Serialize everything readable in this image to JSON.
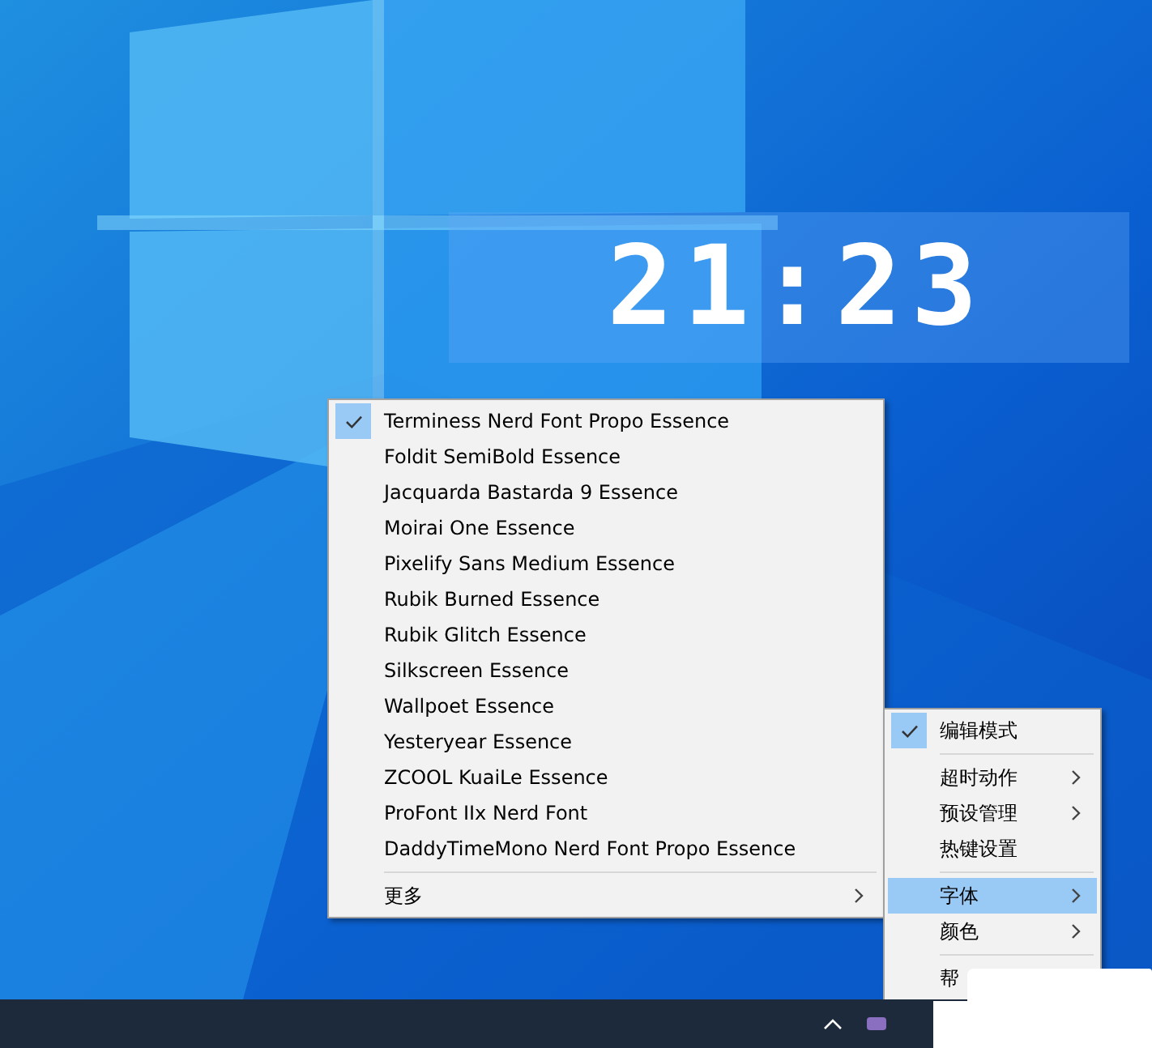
{
  "clock": {
    "time": "21:23"
  },
  "font_menu": {
    "items": [
      {
        "kind": "item",
        "label": "Terminess Nerd Font Propo Essence",
        "checked": true,
        "submenu": false,
        "selected": false
      },
      {
        "kind": "item",
        "label": "Foldit SemiBold Essence",
        "checked": false,
        "submenu": false,
        "selected": false
      },
      {
        "kind": "item",
        "label": "Jacquarda Bastarda 9 Essence",
        "checked": false,
        "submenu": false,
        "selected": false
      },
      {
        "kind": "item",
        "label": "Moirai One Essence",
        "checked": false,
        "submenu": false,
        "selected": false
      },
      {
        "kind": "item",
        "label": "Pixelify Sans Medium Essence",
        "checked": false,
        "submenu": false,
        "selected": false
      },
      {
        "kind": "item",
        "label": "Rubik Burned Essence",
        "checked": false,
        "submenu": false,
        "selected": false
      },
      {
        "kind": "item",
        "label": "Rubik Glitch Essence",
        "checked": false,
        "submenu": false,
        "selected": false
      },
      {
        "kind": "item",
        "label": "Silkscreen Essence",
        "checked": false,
        "submenu": false,
        "selected": false
      },
      {
        "kind": "item",
        "label": "Wallpoet Essence",
        "checked": false,
        "submenu": false,
        "selected": false
      },
      {
        "kind": "item",
        "label": "Yesteryear Essence",
        "checked": false,
        "submenu": false,
        "selected": false
      },
      {
        "kind": "item",
        "label": "ZCOOL KuaiLe Essence",
        "checked": false,
        "submenu": false,
        "selected": false
      },
      {
        "kind": "item",
        "label": "ProFont IIx Nerd Font",
        "checked": false,
        "submenu": false,
        "selected": false
      },
      {
        "kind": "item",
        "label": "DaddyTimeMono Nerd Font Propo Essence",
        "checked": false,
        "submenu": false,
        "selected": false
      },
      {
        "kind": "separator"
      },
      {
        "kind": "item",
        "label": "更多",
        "checked": false,
        "submenu": true,
        "selected": false
      }
    ]
  },
  "tray_menu": {
    "items": [
      {
        "kind": "item",
        "label": "编辑模式",
        "checked": true,
        "submenu": false,
        "selected": false
      },
      {
        "kind": "separator"
      },
      {
        "kind": "item",
        "label": "超时动作",
        "checked": false,
        "submenu": true,
        "selected": false
      },
      {
        "kind": "item",
        "label": "预设管理",
        "checked": false,
        "submenu": true,
        "selected": false
      },
      {
        "kind": "item",
        "label": "热键设置",
        "checked": false,
        "submenu": false,
        "selected": false
      },
      {
        "kind": "separator"
      },
      {
        "kind": "item",
        "label": "字体",
        "checked": false,
        "submenu": true,
        "selected": true
      },
      {
        "kind": "item",
        "label": "颜色",
        "checked": false,
        "submenu": true,
        "selected": false
      },
      {
        "kind": "separator"
      },
      {
        "kind": "item",
        "label": "帮",
        "checked": false,
        "submenu": false,
        "selected": false
      }
    ]
  }
}
